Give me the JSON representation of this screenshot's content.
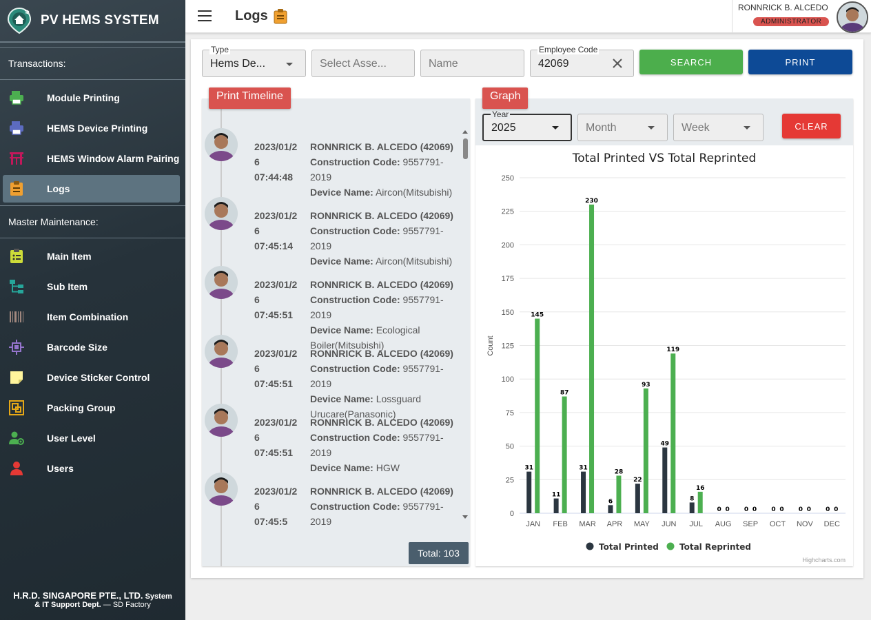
{
  "app": {
    "brand": "PV HEMS SYSTEM",
    "page_title": "Logs",
    "footer_line1": "H.R.D. SINGAPORE PTE., LTD.",
    "footer_line1b": "System",
    "footer_line2": "& IT Support Dept.",
    "footer_line2b": "— SD Factory"
  },
  "user": {
    "name": "RONNRICK B. ALCEDO",
    "role": "ADMINISTRATOR"
  },
  "sidebar": {
    "transactions_heading": "Transactions:",
    "transactions": [
      {
        "label": "Module Printing",
        "icon": "printer-icon",
        "color": "#4caf50"
      },
      {
        "label": "HEMS Device Printing",
        "icon": "printer-icon",
        "color": "#5c6bc0"
      },
      {
        "label": "HEMS Window Alarm Pairing",
        "icon": "gate-icon",
        "color": "#c2185b"
      },
      {
        "label": "Logs",
        "icon": "clipboard-icon",
        "color": "#f0a030",
        "active": true
      }
    ],
    "maintenance_heading": "Master Maintenance:",
    "maintenance": [
      {
        "label": "Main Item",
        "icon": "clipboard-list-icon",
        "color": "#cddc39"
      },
      {
        "label": "Sub Item",
        "icon": "sitemap-icon",
        "color": "#26a69a"
      },
      {
        "label": "Item Combination",
        "icon": "barcode-icon",
        "color": "#a1887f"
      },
      {
        "label": "Barcode Size",
        "icon": "resize-icon",
        "color": "#9575cd"
      },
      {
        "label": "Device Sticker Control",
        "icon": "sticky-note-icon",
        "color": "#fff59d"
      },
      {
        "label": "Packing Group",
        "icon": "group-icon",
        "color": "#e6a817"
      },
      {
        "label": "User Level",
        "icon": "user-cog-icon",
        "color": "#4caf50"
      },
      {
        "label": "Users",
        "icon": "user-icon",
        "color": "#e53935"
      }
    ]
  },
  "filters": {
    "type_label": "Type",
    "type_value": "Hems De...",
    "asset_placeholder": "Select Asse...",
    "name_placeholder": "Name",
    "employee_label": "Employee Code",
    "employee_value": "42069",
    "search_label": "SEARCH",
    "print_label": "PRINT"
  },
  "timeline": {
    "tab_label": "Print Timeline",
    "total": "Total: 103",
    "entries": [
      {
        "date": "2023/01/26",
        "time": "07:44:48",
        "name": "RONNRICK B. ALCEDO (42069)",
        "cc_label": "Construction Code:",
        "cc": "9557791-2019",
        "dn_label": "Device Name:",
        "device": "Aircon(Mitsubishi)"
      },
      {
        "date": "2023/01/26",
        "time": "07:45:14",
        "name": "RONNRICK B. ALCEDO (42069)",
        "cc_label": "Construction Code:",
        "cc": "9557791-2019",
        "dn_label": "Device Name:",
        "device": "Aircon(Mitsubishi)"
      },
      {
        "date": "2023/01/26",
        "time": "07:45:51",
        "name": "RONNRICK B. ALCEDO (42069)",
        "cc_label": "Construction Code:",
        "cc": "9557791-2019",
        "dn_label": "Device Name:",
        "device": "Ecological Boiler(Mitsubishi)"
      },
      {
        "date": "2023/01/26",
        "time": "07:45:51",
        "name": "RONNRICK B. ALCEDO (42069)",
        "cc_label": "Construction Code:",
        "cc": "9557791-2019",
        "dn_label": "Device Name:",
        "device": "Lossguard Urucare(Panasonic)"
      },
      {
        "date": "2023/01/26",
        "time": "07:45:51",
        "name": "RONNRICK B. ALCEDO (42069)",
        "cc_label": "Construction Code:",
        "cc": "9557791-2019",
        "dn_label": "Device Name:",
        "device": "HGW"
      },
      {
        "date": "2023/01/26",
        "time": "07:45:5",
        "name": "RONNRICK B. ALCEDO (42069)",
        "cc_label": "Construction Code:",
        "cc": "9557791-2019",
        "dn_label": "",
        "device": ""
      }
    ]
  },
  "graph": {
    "tab_label": "Graph",
    "year_label": "Year",
    "year_value": "2025",
    "month_placeholder": "Month",
    "week_placeholder": "Week",
    "clear_label": "CLEAR",
    "credit": "Highcharts.com"
  },
  "chart_data": {
    "type": "bar",
    "title": "Total Printed VS Total Reprinted",
    "ylabel": "Count",
    "xlabel": "",
    "ylim": [
      0,
      250
    ],
    "yticks": [
      0,
      25,
      50,
      75,
      100,
      125,
      150,
      175,
      200,
      225,
      250
    ],
    "categories": [
      "JAN",
      "FEB",
      "MAR",
      "APR",
      "MAY",
      "JUN",
      "JUL",
      "AUG",
      "SEP",
      "OCT",
      "NOV",
      "DEC"
    ],
    "series": [
      {
        "name": "Total Printed",
        "color": "#2b3640",
        "values": [
          31,
          11,
          31,
          6,
          22,
          49,
          8,
          0,
          0,
          0,
          0,
          0
        ]
      },
      {
        "name": "Total Reprinted",
        "color": "#4caf50",
        "values": [
          145,
          87,
          230,
          28,
          93,
          119,
          16,
          0,
          0,
          0,
          0,
          0
        ]
      }
    ],
    "legend_position": "bottom",
    "grid": true
  }
}
